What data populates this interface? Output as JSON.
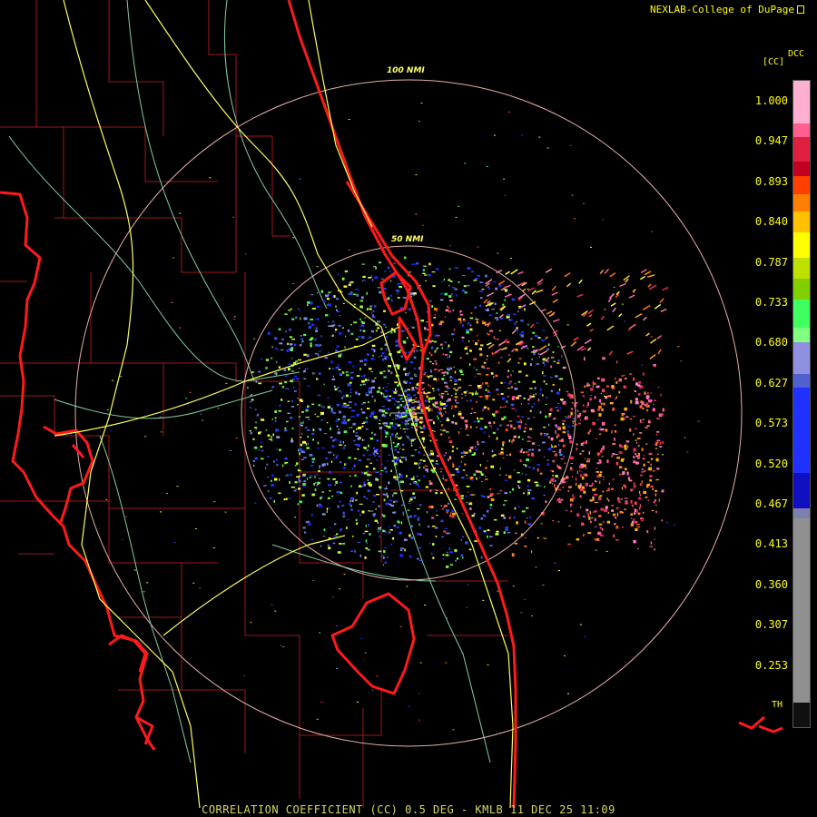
{
  "header": {
    "credit": "NEXLAB-College of DuPage"
  },
  "footer": {
    "caption": "CORRELATION COEFFICIENT (CC) 0.5 DEG - KMLB 11 DEC 25 11:09"
  },
  "range_rings": {
    "inner_label": "50 NMI",
    "outer_label": "100 NMI"
  },
  "legend": {
    "title_left": "[CC]",
    "title_right": "DCC",
    "bottom_label": "TH",
    "ticks": [
      "1.000",
      "0.947",
      "0.893",
      "0.840",
      "0.787",
      "0.733",
      "0.680",
      "0.627",
      "0.573",
      "0.520",
      "0.467",
      "0.413",
      "0.360",
      "0.307",
      "0.253"
    ]
  },
  "colors": {
    "state_border": "#ff1a1a",
    "county_lines": "#a01818",
    "highways": "#ffff55",
    "roads": "#7fd0a0",
    "ring": "#e8b0a8",
    "text": "#ffff00"
  }
}
